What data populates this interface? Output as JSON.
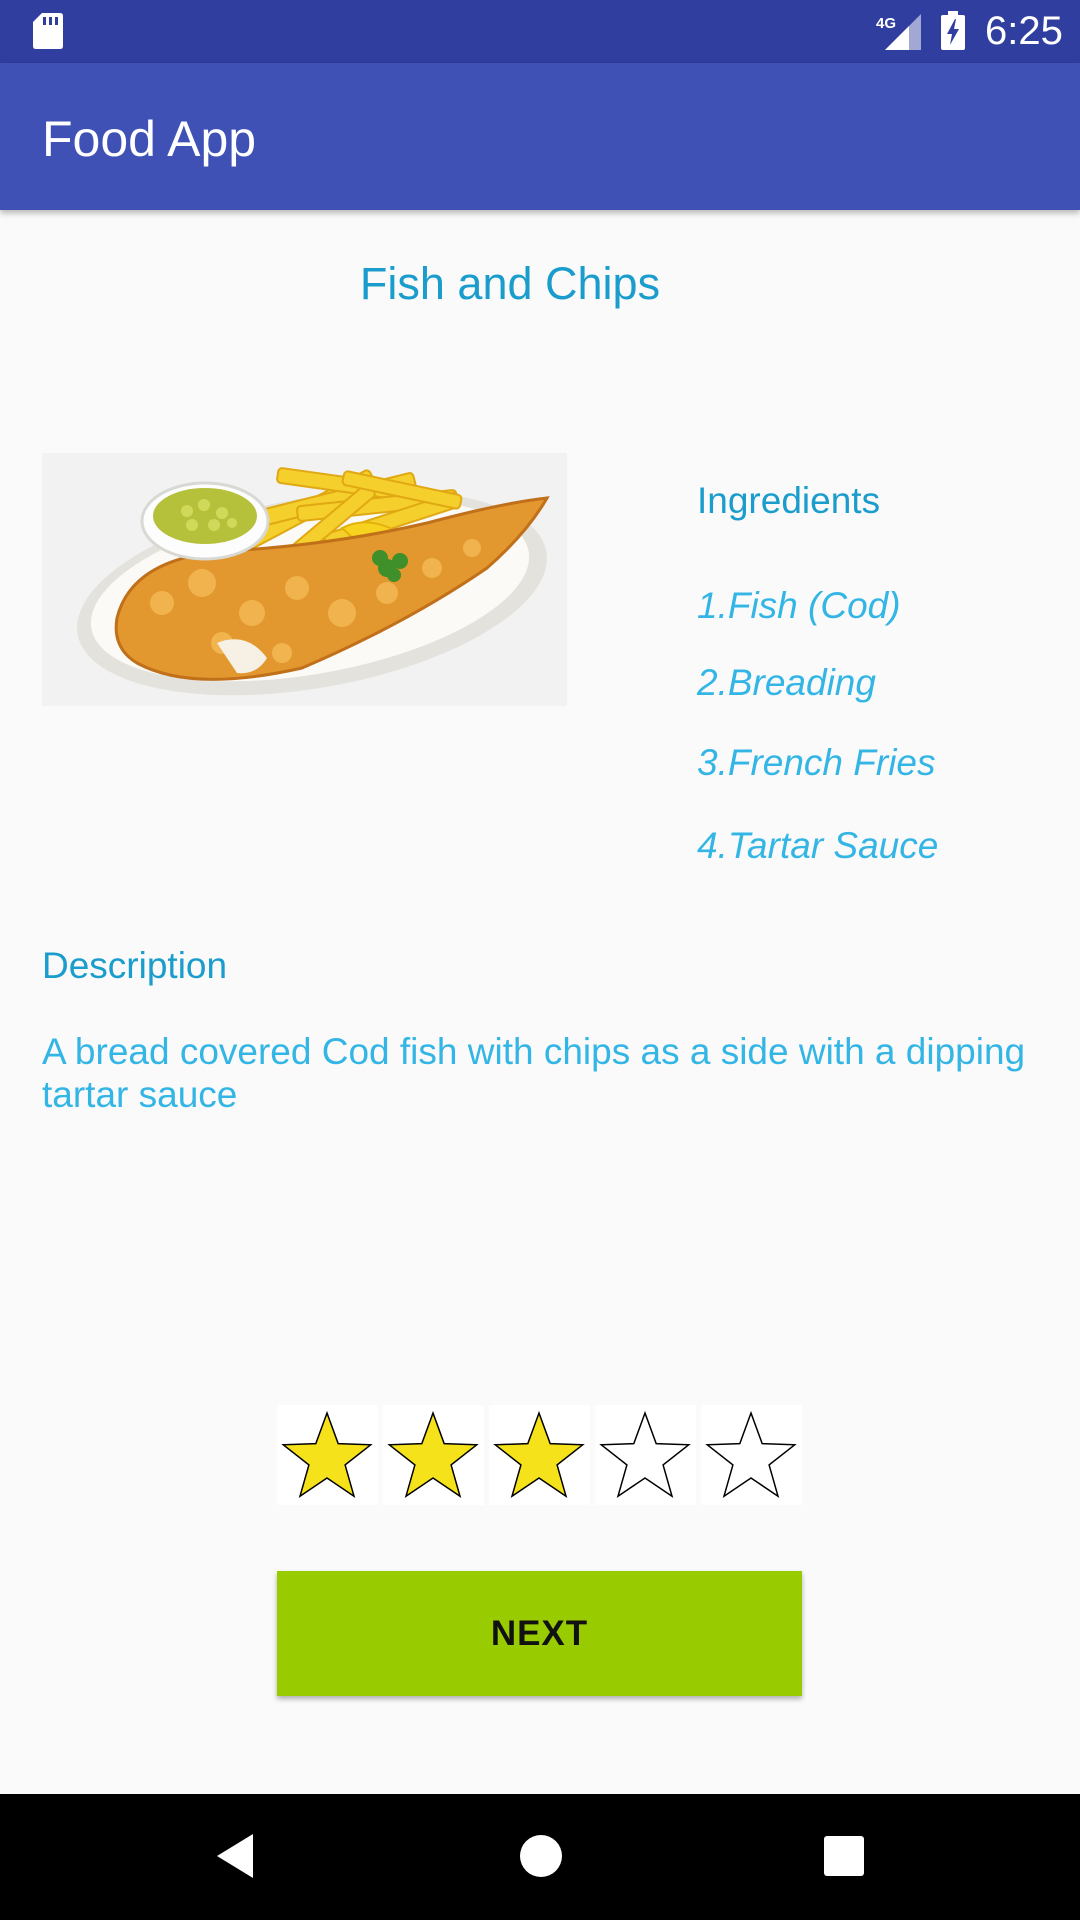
{
  "status_bar": {
    "time": "6:25",
    "network_type": "4G",
    "icons": [
      "sd-card-icon",
      "signal-icon",
      "battery-charging-icon"
    ]
  },
  "app_bar": {
    "title": "Food App",
    "background_color": "#3f51b5",
    "status_bar_color": "#303f9f"
  },
  "dish": {
    "title": "Fish and Chips",
    "image_description": "fish-and-chips-plate"
  },
  "ingredients": {
    "header": "Ingredients",
    "items": [
      "1.Fish (Cod)",
      "2.Breading",
      "3.French Fries",
      "4.Tartar Sauce"
    ]
  },
  "description": {
    "header": "Description",
    "text": "A bread covered Cod fish with chips as a side with a dipping tartar sauce"
  },
  "rating": {
    "value": 3,
    "max": 5,
    "filled_color": "#f5e21b",
    "empty_color": "#ffffff"
  },
  "next_button": {
    "label": "NEXT",
    "color": "#99cc00"
  },
  "colors": {
    "accent_text": "#1a9dcc",
    "light_text": "#33b5e5"
  },
  "nav_bar": {
    "icons": [
      "back-icon",
      "home-icon",
      "recents-icon"
    ]
  }
}
